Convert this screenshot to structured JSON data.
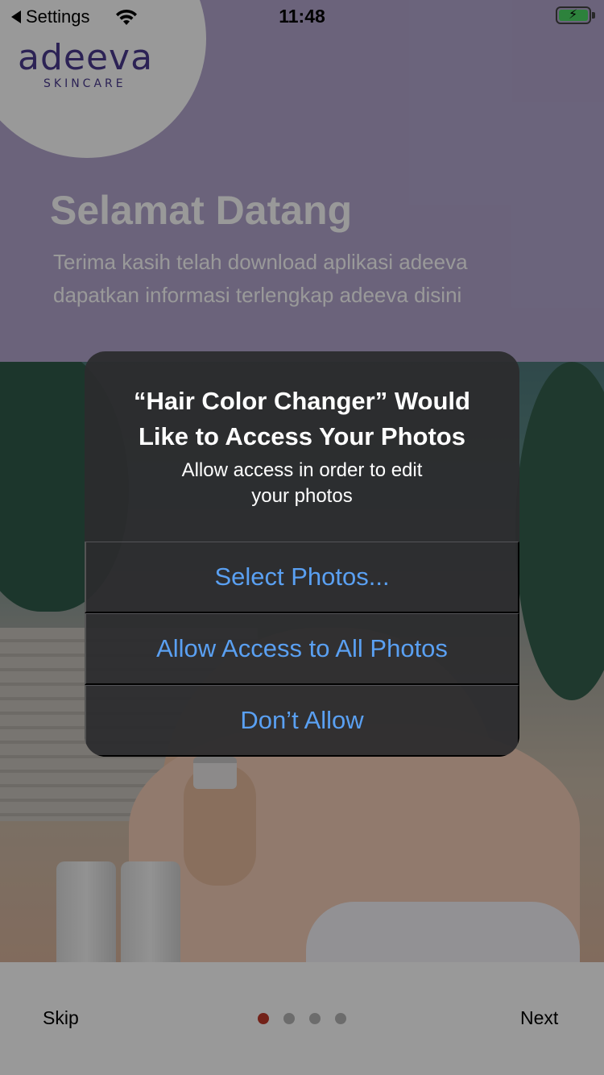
{
  "status_bar": {
    "back_label": "Settings",
    "time": "11:48",
    "battery_state": "charging"
  },
  "brand": {
    "logo_name": "adeeva",
    "logo_sub": "SKINCARE"
  },
  "welcome": {
    "title": "Selamat Datang",
    "text_line1": "Terima kasih telah download aplikasi adeeva",
    "text_line2": "dapatkan informasi terlengkap adeeva disini"
  },
  "onboarding": {
    "skip_label": "Skip",
    "next_label": "Next",
    "page_count": 4,
    "active_page": 1
  },
  "alert": {
    "title_line1": "“Hair Color Changer” Would",
    "title_line2": "Like to Access Your Photos",
    "message_line1": "Allow access in order to edit",
    "message_line2": "your photos",
    "buttons": [
      {
        "label": "Select Photos..."
      },
      {
        "label": "Allow Access to All Photos"
      },
      {
        "label": "Don’t Allow"
      }
    ]
  },
  "colors": {
    "alert_button": "#5aa0f2",
    "active_dot": "#c0392b",
    "hero_background": "#b3a6ce",
    "logo_text": "#4a3a8e"
  }
}
